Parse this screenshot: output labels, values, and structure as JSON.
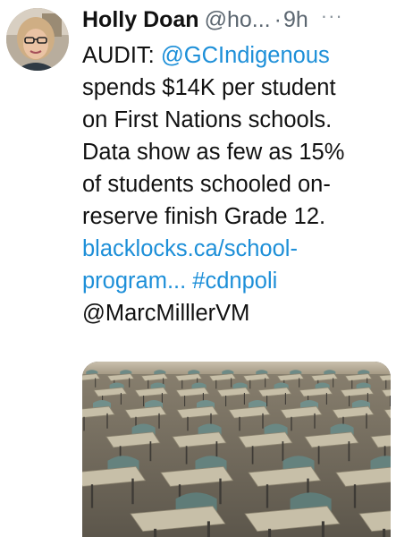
{
  "author": {
    "name": "Holly Doan",
    "handle": "@ho...",
    "separator": "·",
    "time": "9h",
    "more": "···"
  },
  "tweet": {
    "lines": [
      {
        "parts": [
          {
            "text": "AUDIT: ",
            "link": false
          },
          {
            "text": "@GCIndigenous",
            "link": true
          }
        ]
      },
      {
        "parts": [
          {
            "text": "spends $14K per student",
            "link": false
          }
        ]
      },
      {
        "parts": [
          {
            "text": "on First Nations schools.",
            "link": false
          }
        ]
      },
      {
        "parts": [
          {
            "text": "Data show as few as 15%",
            "link": false
          }
        ]
      },
      {
        "parts": [
          {
            "text": "of students schooled on-",
            "link": false
          }
        ]
      },
      {
        "parts": [
          {
            "text": "reserve finish Grade 12.",
            "link": false
          }
        ]
      },
      {
        "parts": [
          {
            "text": "blacklocks.ca/school-",
            "link": true
          }
        ]
      },
      {
        "parts": [
          {
            "text": "program... ",
            "link": true
          },
          {
            "text": "#cdnpoli",
            "link": true
          }
        ]
      },
      {
        "parts": [
          {
            "text": "@MarcMilllerVM",
            "link": false
          }
        ]
      }
    ]
  },
  "media": {
    "description_icon": "classroom-desks-photo"
  },
  "colors": {
    "link": "#1d8fd8",
    "muted": "#5b6670",
    "text": "#111111"
  }
}
